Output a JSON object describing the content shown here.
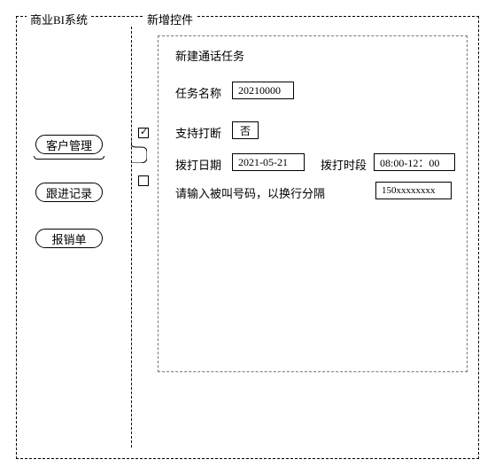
{
  "sidebar": {
    "title": "商业BI系统",
    "items": [
      {
        "label": "客户管理"
      },
      {
        "label": "跟进记录"
      },
      {
        "label": "报销单"
      }
    ]
  },
  "panel": {
    "title": "新增控件",
    "form": {
      "heading": "新建通话任务",
      "task_name_label": "任务名称",
      "task_name_value": "20210000",
      "interrupt_label": "支持打断",
      "interrupt_value": "否",
      "date_label": "拨打日期",
      "date_value": "2021-05-21",
      "time_label": "拨打时段",
      "time_value": "08:00-12：00",
      "phone_hint": "请输入被叫号码，以换行分隔",
      "phone_value": "150xxxxxxxx"
    },
    "checkboxes": {
      "cb1_checked": "✓"
    }
  }
}
